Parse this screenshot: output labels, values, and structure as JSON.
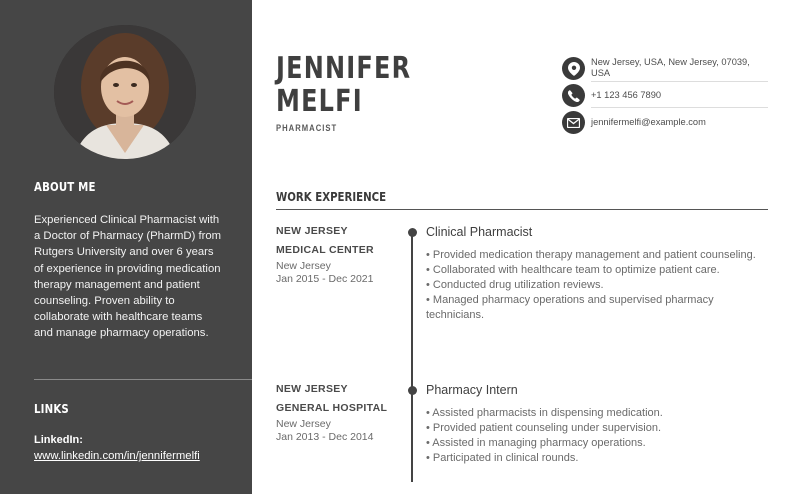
{
  "sidebar": {
    "about_heading": "ABOUT ME",
    "about_text": "Experienced Clinical Pharmacist with a Doctor of Pharmacy (PharmD) from Rutgers University and over 6 years of experience in providing medication therapy management and patient counseling. Proven ability to collaborate with healthcare teams and manage pharmacy operations.",
    "links_heading": "LINKS",
    "linkedin_label": "LinkedIn:",
    "linkedin_url": "www.linkedin.com/in/jennifermelfi"
  },
  "header": {
    "first_name": "JENNIFER",
    "last_name": "MELFI",
    "title": "PHARMACIST"
  },
  "contact": {
    "address": "New Jersey, USA, New Jersey, 07039, USA",
    "phone": "+1 123 456 7890",
    "email": "jennifermelfi@example.com",
    "icons": [
      "location-pin-icon",
      "phone-icon",
      "email-icon"
    ]
  },
  "work": {
    "heading": "WORK EXPERIENCE",
    "entries": [
      {
        "employer_line1": "NEW JERSEY",
        "employer_line2": "MEDICAL CENTER",
        "location": "New Jersey",
        "dates": "Jan 2015 - Dec 2021",
        "role": "Clinical Pharmacist",
        "bullets": [
          "• Provided medication therapy management and patient counseling.",
          "• Collaborated with healthcare team to optimize patient care.",
          "• Conducted drug utilization reviews.",
          "• Managed pharmacy operations and supervised pharmacy technicians."
        ]
      },
      {
        "employer_line1": "NEW JERSEY",
        "employer_line2": "GENERAL HOSPITAL",
        "location": "New Jersey",
        "dates": "Jan 2013 - Dec 2014",
        "role": "Pharmacy Intern",
        "bullets": [
          "• Assisted pharmacists in dispensing medication.",
          "• Provided patient counseling under supervision.",
          "• Assisted in managing pharmacy operations.",
          "• Participated in clinical rounds."
        ]
      }
    ]
  },
  "colors": {
    "sidebar_bg": "#464646",
    "text_dark": "#3f3f3f",
    "text_muted": "#6a6a6a"
  }
}
